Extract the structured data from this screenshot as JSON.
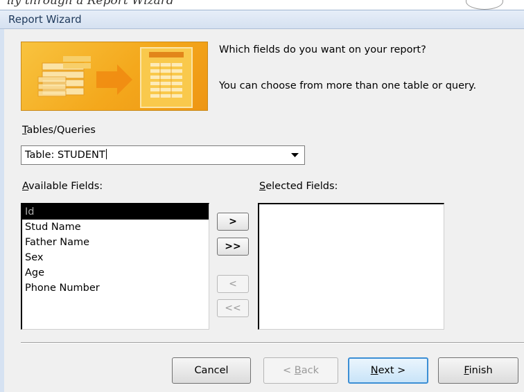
{
  "window": {
    "title": "Report Wizard"
  },
  "header_cut_text": "ily through a Report Wizard",
  "prompt": {
    "question": "Which fields do you want on your report?",
    "hint": "You can choose from more than one table or query."
  },
  "tables_queries": {
    "label_prefix": "",
    "label_underlined": "T",
    "label_rest": "ables/Queries",
    "value": "Table: STUDENT"
  },
  "available_fields": {
    "label_underlined": "A",
    "label_rest": "vailable Fields:",
    "items": [
      "Id",
      "Stud Name",
      "Father Name",
      "Sex",
      "Age",
      "Phone Number"
    ],
    "selected_item": "Id"
  },
  "selected_fields": {
    "label_underlined": "S",
    "label_rest": "elected Fields:",
    "items": []
  },
  "move_buttons": {
    "add_one": ">",
    "add_all": ">>",
    "remove_one": "<",
    "remove_all": "<<"
  },
  "footer_buttons": {
    "cancel": "Cancel",
    "back_prefix": "< ",
    "back_underlined": "B",
    "back_rest": "ack",
    "next_underlined": "N",
    "next_rest": "ext >",
    "finish_underlined": "F",
    "finish_rest": "inish"
  },
  "colors": {
    "banner_orange": "#f4a81c",
    "selection_bg": "#000000",
    "default_button_border": "#3b8ed4",
    "title_text": "#1e395b"
  },
  "icons": [
    "dropdown-arrow-icon",
    "report-wizard-illustration"
  ]
}
